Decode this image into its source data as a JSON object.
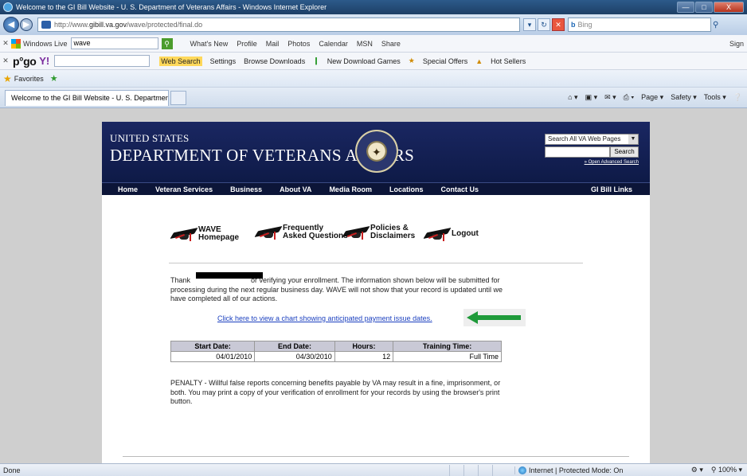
{
  "window": {
    "title": "Welcome to the GI Bill Website - U. S. Department of Veterans Affairs - Windows Internet Explorer",
    "minimize": "—",
    "maximize": "□",
    "close": "X"
  },
  "address_bar": {
    "url_prefix": "http://www.",
    "url_domain": "gibill.va.gov",
    "url_path": "/wave/protected/final.do",
    "bing_label": "b",
    "bing_placeholder": "Bing"
  },
  "windows_live_toolbar": {
    "brand": "Windows Live",
    "search_value": "wave",
    "items": [
      "What's New",
      "Profile",
      "Mail",
      "Photos",
      "Calendar",
      "MSN",
      "Share"
    ],
    "signin": "Sign"
  },
  "pogo_toolbar": {
    "brand": "p°go",
    "yahoo": "Y!",
    "web_search": "Web Search",
    "settings": "Settings",
    "browse_downloads": "Browse Downloads",
    "new_download_games": "New Download Games",
    "special_offers": "Special Offers",
    "hot_sellers": "Hot Sellers"
  },
  "favorites_bar": {
    "label": "Favorites"
  },
  "tab": {
    "label": "Welcome to the GI Bill Website - U. S. Departmen..."
  },
  "command_bar": {
    "items": [
      "Page ▾",
      "Safety ▾",
      "Tools ▾"
    ]
  },
  "va_header": {
    "line1": "UNITED STATES",
    "line2": "DEPARTMENT OF VETERANS AFFAIRS",
    "search_select": "Search All VA Web Pages",
    "search_button": "Search",
    "advanced_search": "» Open Advanced Search"
  },
  "va_nav": {
    "items": [
      "Home",
      "Veteran Services",
      "Business",
      "About VA",
      "Media Room",
      "Locations",
      "Contact Us"
    ],
    "right": "GI Bill Links"
  },
  "wave_nav": {
    "home_line1": "WAVE",
    "home_line2": "Homepage",
    "faq_line1": "Frequently",
    "faq_line2": "Asked Questions",
    "policies_line1": "Policies &",
    "policies_line2": "Disclaimers",
    "logout": "Logout"
  },
  "message": {
    "thanks_prefix": "Thank",
    "thanks_rest": "or verifying your enrollment. The information shown below will be submitted for processing during the next regular business day. WAVE will not show that your record is updated until we have completed all of our actions.",
    "chart_link": "Click here to view a chart showing anticipated payment issue dates."
  },
  "enrollment_table": {
    "headers": [
      "Start Date:",
      "End Date:",
      "Hours:",
      "Training Time:"
    ],
    "row": [
      "04/01/2010",
      "04/30/2010",
      "12",
      "Full Time"
    ]
  },
  "penalty": {
    "text": "PENALTY - Willful false reports concerning benefits payable by VA may result in a fine, imprisonment, or both. You may print a copy of your verification of enrollment for your records by using the browser's print button."
  },
  "status_bar": {
    "status": "Done",
    "zone": "Internet | Protected Mode: On",
    "zoom": "100%"
  },
  "colors": {
    "va_header": "#1a2762",
    "va_nav": "#0c1538",
    "link": "#1a3fbf",
    "arrow": "#1f9a3a"
  }
}
